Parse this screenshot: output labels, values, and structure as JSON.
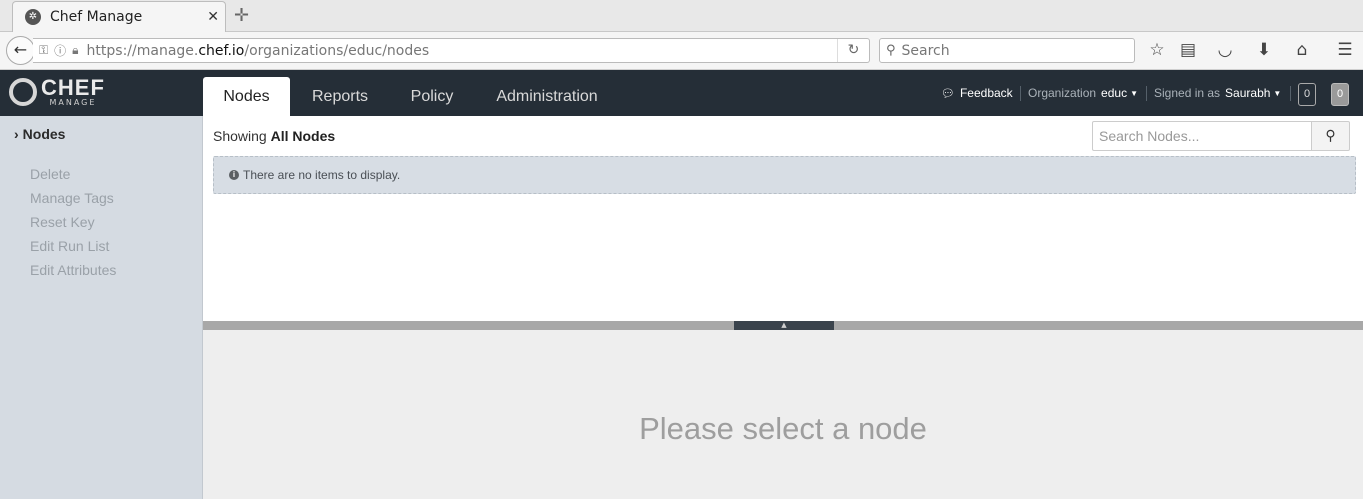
{
  "browser": {
    "tab_title": "Chef Manage",
    "tab_close": "✕",
    "new_tab": "✛",
    "url_prefix": "https://manage.",
    "url_host": "chef.io",
    "url_path": "/organizations/educ/nodes",
    "search_placeholder": "Search"
  },
  "header": {
    "logo_text": "CHEF",
    "logo_sub": "MANAGE",
    "tabs": [
      {
        "label": "Nodes",
        "active": true
      },
      {
        "label": "Reports",
        "active": false
      },
      {
        "label": "Policy",
        "active": false
      },
      {
        "label": "Administration",
        "active": false
      }
    ],
    "feedback_label": "Feedback",
    "organization_label": "Organization",
    "organization_value": "educ",
    "signed_in_label": "Signed in as",
    "signed_in_user": "Saurabh",
    "badge_1": "0",
    "badge_2": "0"
  },
  "sidebar": {
    "title": "Nodes",
    "actions": [
      "Delete",
      "Manage Tags",
      "Reset Key",
      "Edit Run List",
      "Edit Attributes"
    ]
  },
  "main": {
    "showing_prefix": "Showing",
    "showing_value": "All Nodes",
    "search_placeholder": "Search Nodes...",
    "empty_message": "There are no items to display."
  },
  "detail": {
    "message": "Please select a node"
  },
  "colors": {
    "header_bg": "#252e37",
    "sidebar_bg": "#d5dbe2",
    "alert_bg": "#d7dde4",
    "detail_bg": "#eeeeee"
  }
}
